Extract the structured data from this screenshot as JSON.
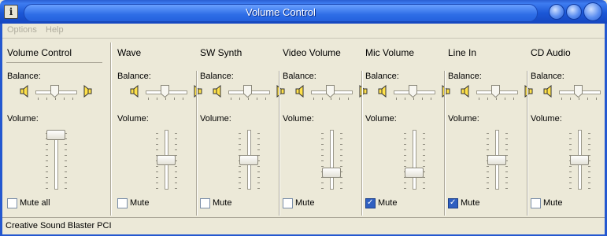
{
  "window": {
    "title": "Volume Control",
    "icon": "info-icon"
  },
  "menu": [
    "Options",
    "Help"
  ],
  "common": {
    "balance_label": "Balance:",
    "volume_label": "Volume:"
  },
  "channels": [
    {
      "name": "Volume Control",
      "mute_label": "Mute all",
      "muted": false,
      "volume_percent": 100,
      "balance": 0
    },
    {
      "name": "Wave",
      "mute_label": "Mute",
      "muted": false,
      "volume_percent": 50,
      "balance": 0
    },
    {
      "name": "SW Synth",
      "mute_label": "Mute",
      "muted": false,
      "volume_percent": 50,
      "balance": 0
    },
    {
      "name": "Video Volume",
      "mute_label": "Mute",
      "muted": false,
      "volume_percent": 25,
      "balance": 0
    },
    {
      "name": "Mic Volume",
      "mute_label": "Mute",
      "muted": true,
      "volume_percent": 25,
      "balance": 0
    },
    {
      "name": "Line In",
      "mute_label": "Mute",
      "muted": true,
      "volume_percent": 50,
      "balance": 0
    },
    {
      "name": "CD Audio",
      "mute_label": "Mute",
      "muted": false,
      "volume_percent": 50,
      "balance": 0
    }
  ],
  "status": {
    "text": "Creative Sound Blaster PCI"
  },
  "colors": {
    "titlebar": "#1b57d6",
    "face": "#ece9d8",
    "check_on": "#2f5fc0"
  }
}
